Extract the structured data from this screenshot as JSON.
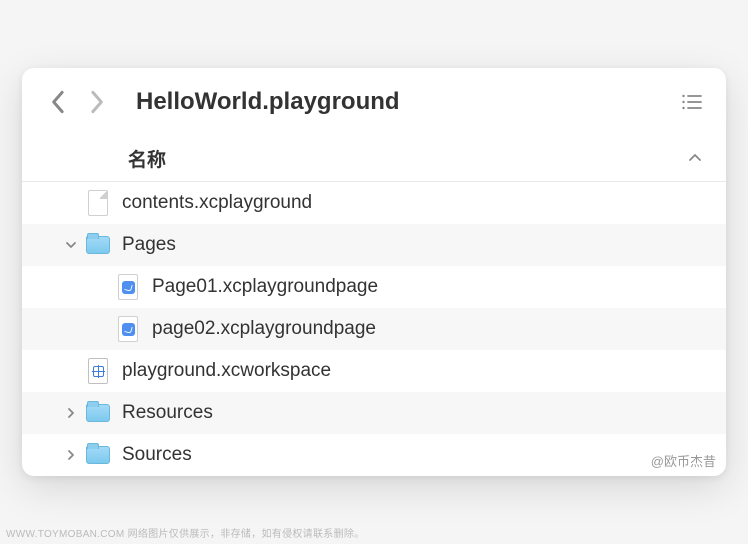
{
  "toolbar": {
    "title": "HelloWorld.playground"
  },
  "header": {
    "name_label": "名称"
  },
  "items": [
    {
      "name": "contents.xcplayground",
      "type": "blank",
      "indent": 0,
      "disclosure": "none"
    },
    {
      "name": "Pages",
      "type": "folder",
      "indent": 0,
      "disclosure": "open"
    },
    {
      "name": "Page01.xcplaygroundpage",
      "type": "swift",
      "indent": 1,
      "disclosure": "none"
    },
    {
      "name": "page02.xcplaygroundpage",
      "type": "swift",
      "indent": 1,
      "disclosure": "none"
    },
    {
      "name": "playground.xcworkspace",
      "type": "xc",
      "indent": 0,
      "disclosure": "none"
    },
    {
      "name": "Resources",
      "type": "folder",
      "indent": 0,
      "disclosure": "closed"
    },
    {
      "name": "Sources",
      "type": "folder",
      "indent": 0,
      "disclosure": "closed"
    }
  ],
  "watermark": "@欧币杰昔",
  "footer": "WWW.TOYMOBAN.COM   网络图片仅供展示，非存储，如有侵权请联系删除。"
}
